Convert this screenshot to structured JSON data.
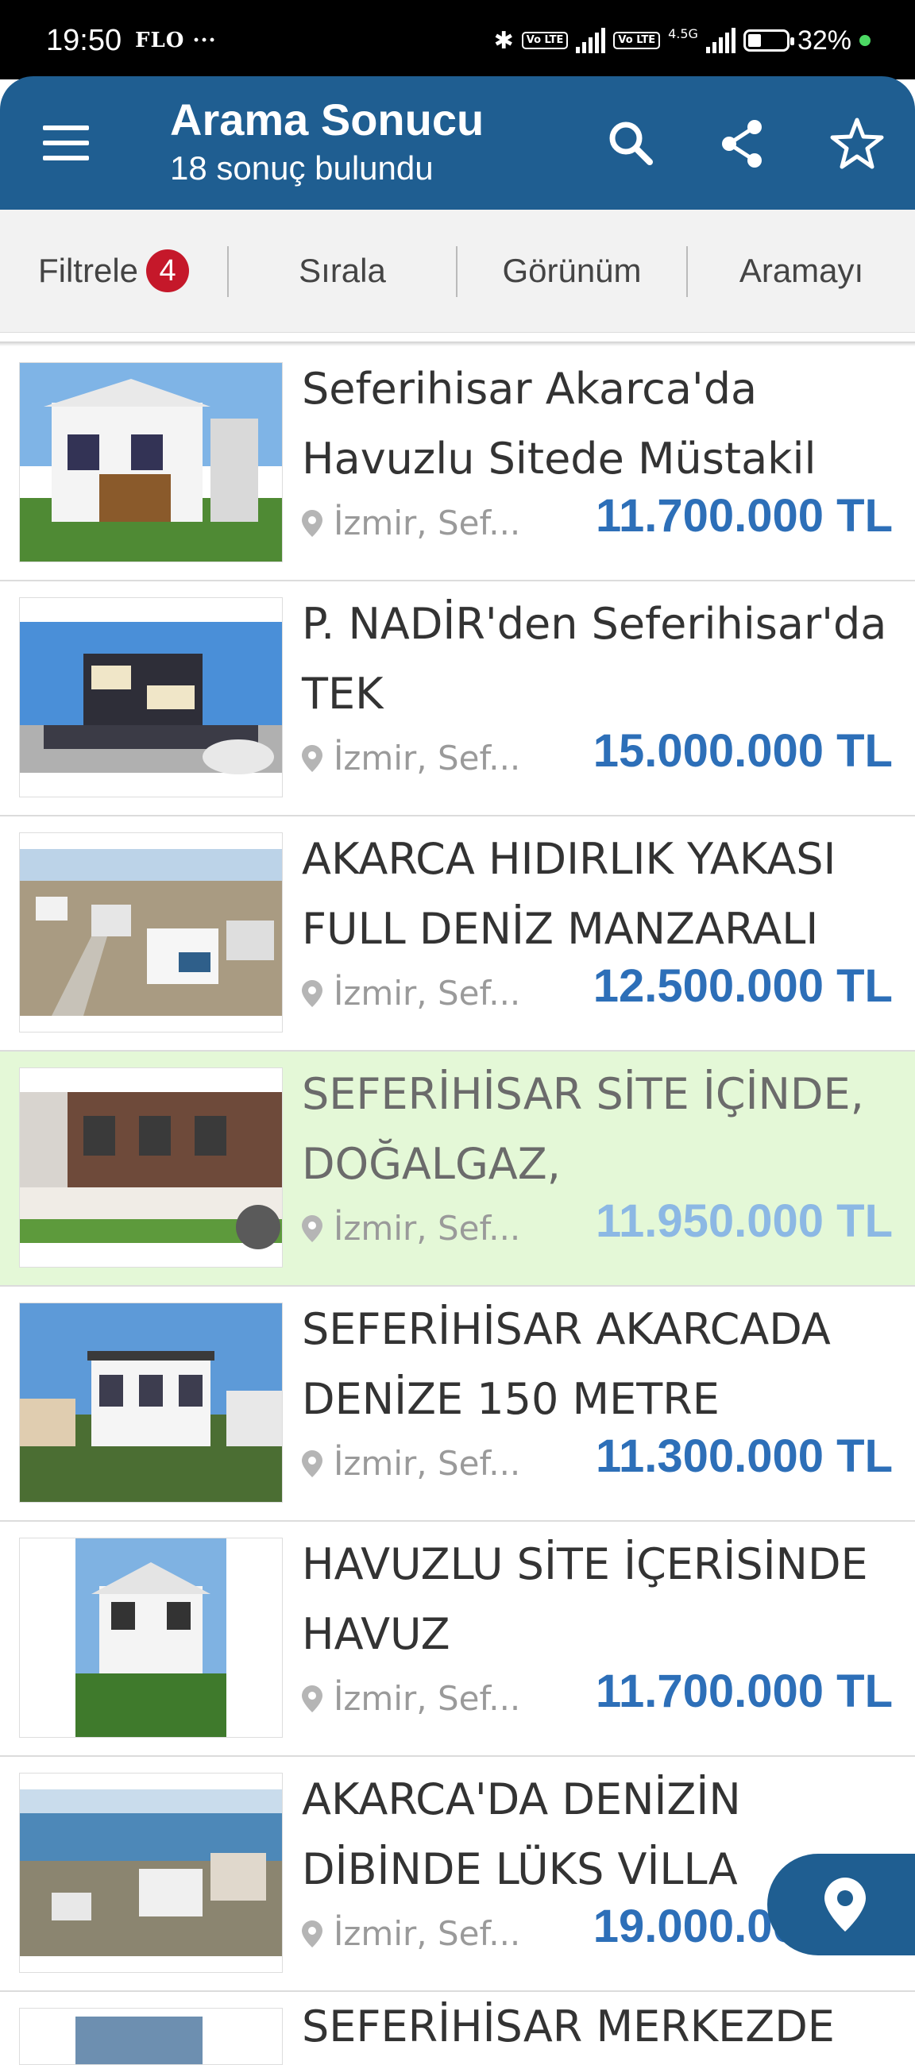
{
  "status_bar": {
    "time": "19:50",
    "carrier": "FLO ···",
    "network": "4.5G",
    "volte_label": "Vo LTE",
    "battery": "32%"
  },
  "app_bar": {
    "title": "Arama Sonucu",
    "subtitle": "18 sonuç bulundu",
    "icons": [
      "menu-icon",
      "search-icon",
      "share-icon",
      "star-icon"
    ]
  },
  "toolbar": {
    "filter_label": "Filtrele",
    "filter_count": "4",
    "sort_label": "Sırala",
    "view_label": "Görünüm",
    "search_label": "Aramayı"
  },
  "listings": [
    {
      "title": "Seferihisar Akarca'da Havuzlu Sitede Müstakil",
      "location": "İzmir, Sef...",
      "price": "11.700.000 TL"
    },
    {
      "title": "P. NADİR'den Seferihisar'da TEK",
      "location": "İzmir, Sef...",
      "price": "15.000.000 TL"
    },
    {
      "title": "AKARCA HIDIRLIK YAKASI FULL DENİZ MANZARALI",
      "location": "İzmir, Sef...",
      "price": "12.500.000 TL"
    },
    {
      "title": "SEFERİHİSAR SİTE İÇİNDE, DOĞALGAZ,",
      "location": "İzmir, Sef...",
      "price": "11.950.000 TL"
    },
    {
      "title": "SEFERİHİSAR AKARCADA DENİZE 150 METRE",
      "location": "İzmir, Sef...",
      "price": "11.300.000 TL"
    },
    {
      "title": "HAVUZLU SİTE İÇERİSİNDE HAVUZ",
      "location": "İzmir, Sef...",
      "price": "11.700.000 TL"
    },
    {
      "title": "AKARCA'DA DENİZİN DİBİNDE LÜKS VİLLA",
      "location": "İzmir, Sef...",
      "price": "19.000.000 TL"
    }
  ],
  "partial_next_title": "SEFERİHİSAR MERKEZDE",
  "colors": {
    "primary": "#1f5e91",
    "price": "#2d6fb8",
    "highlight_bg": "#e4f8d7",
    "badge": "#c5182a"
  }
}
